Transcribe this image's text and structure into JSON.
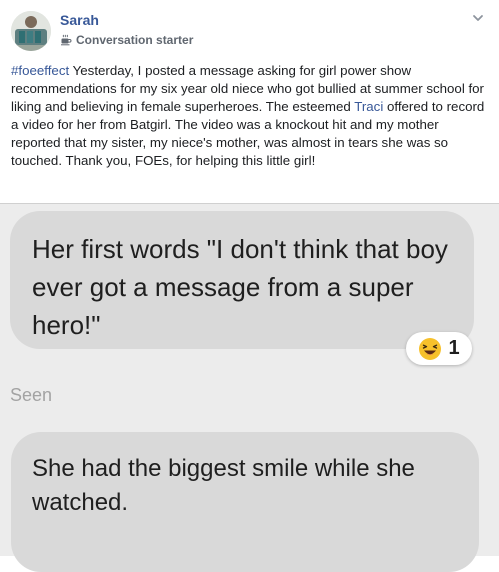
{
  "post": {
    "author": "Sarah",
    "badge_label": "Conversation starter",
    "hashtag": "#foeeffect",
    "text_part1": " Yesterday, I posted a message asking for girl power show recommendations for my six year old niece who got bullied at summer school for liking and believing in female superheroes. The esteemed ",
    "mention": "Traci",
    "text_part2": " offered to record a video for her from Batgirl. The video was a knockout hit and my mother reported that my sister, my niece's mother, was almost in tears she was so touched. Thank you, FOEs, for helping this little girl!",
    "icons": {
      "badge": "coffee-cup-icon",
      "menu": "chevron-down-icon"
    }
  },
  "chat": {
    "message1": "Her first words \"I don't think that boy ever got a message from a super hero!\"",
    "reaction_emoji": "laughing-face-emoji",
    "reaction_count": "1",
    "seen_label": "Seen",
    "message2": "She had the biggest smile while she watched."
  },
  "colors": {
    "link": "#385898",
    "bubble": "#d9d9d9",
    "chat_background": "#ececec",
    "seen_text": "#a3a3a3"
  }
}
